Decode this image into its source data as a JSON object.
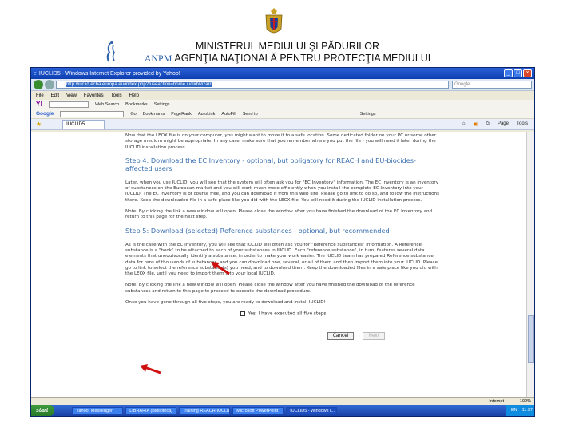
{
  "header": {
    "ministry": "MINISTERUL MEDIULUI ŞI PĂDURILOR",
    "agency": "AGENŢIA NAŢIONALĂ PENTRU PROTECŢIA MEDIULUI",
    "logo_text": "ANPM"
  },
  "browser": {
    "title": "IUCLID5 - Windows Internet Explorer provided by Yahoo!",
    "url": "http://iuclid.echa.europa.eu/index.php?fuseaction=home.iuclidWizard",
    "search_placeholder": "Google",
    "menu": [
      "File",
      "Edit",
      "View",
      "Favorites",
      "Tools",
      "Help"
    ],
    "toolbar1": [
      "Web Search",
      "Bookmarks",
      "Settings"
    ],
    "toolbar2": [
      "Go",
      "Bookmarks",
      "PageRank",
      "AutoLink",
      "AutoFill",
      "Send to",
      "Settings"
    ],
    "tab_label": "IUCLID5",
    "tab_tools": [
      "Page",
      "Tools"
    ],
    "status_zone": "Internet",
    "zoom": "100%"
  },
  "content": {
    "intro": "Now that the LEOX file is on your computer, you might want to move it to a safe location. Some dedicated folder on your PC or some other storage medium might be appropriate. In any case, make sure that you remember where you put the file - you will need it later during the IUCLID installation process.",
    "step4_title": "Step 4: Download the EC Inventory - optional, but obligatory for REACH and EU-biocides-affected users",
    "step4_text": "Later, when you use IUCLID, you will see that the system will often ask you for \"EC Inventory\" information. The EC Inventory is an inventory of substances on the European market and you will work much more efficiently when you install the complete EC Inventory into your IUCLID. The EC Inventory is of course free, and you can download it from this web site. Please go to link to do so, and follow the instructions there. Keep the downloaded file in a safe place like you did with the LEOX file. You will need it during the IUCLID installation process.",
    "step4_note": "Note: By clicking the link a new window will open. Please close the window after you have finished the download of the EC Inventory and return to this page for the next step.",
    "step5_title": "Step 5: Download (selected) Reference substances - optional, but recommended",
    "step5_text": "As is the case with the EC Inventory, you will see that IUCLID will often ask you for \"Reference substances\" information. A Reference substance is a \"book\" to be attached to each of your substances in IUCLID. Each \"reference substance\", in turn, features several data elements that unequivocally identify a substance, in order to make your work easier. The IUCLID team has prepared Reference substance data for tens of thousands of substances, and you can download one, several, or all of them and then import them into your IUCLID. Please go to link to select the reference substance(s) you need, and to download them. Keep the downloaded files in a safe place like you did with the LEOX file, until you need to import them into your local IUCLID.",
    "step5_note": "Note: By clicking the link a new window will open. Please close the window after you have finished the download of the reference substances and return to this page to proceed to execute the download procedure.",
    "final": "Once you have gone through all five steps, you are ready to download and install IUCLID!",
    "checkbox_label": "Yes, I have executed all five steps",
    "cancel_label": "Cancel",
    "next_label": "Next"
  },
  "taskbar": {
    "start": "start",
    "tasks": [
      "Yahoo! Messenger",
      "LIBRARIA (Biblioteca)",
      "Training REACH-IUCLID",
      "Microsoft PowerPoint",
      "IUCLID5 - Windows I..."
    ],
    "tray_lang": "EN",
    "clock": "11:37"
  },
  "colors": {
    "step_heading": "#3a6fb0",
    "titlebar": "#0d3fb0",
    "arrow": "#d01010"
  }
}
